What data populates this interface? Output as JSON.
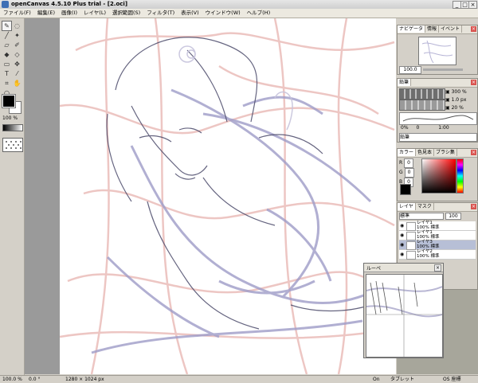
{
  "window": {
    "title": "openCanvas 4.5.10 Plus trial - [2.oci]",
    "controls": [
      "_",
      "□",
      "×"
    ]
  },
  "menu": [
    "ファイル(F)",
    "編集(E)",
    "画像(I)",
    "レイヤ(L)",
    "選択範囲(S)",
    "フィルタ(T)",
    "表示(V)",
    "ウインドウ(W)",
    "ヘルプ(H)"
  ],
  "toolbox": {
    "tools": [
      {
        "name": "pen-tool-icon",
        "glyph": "✎"
      },
      {
        "name": "lasso-tool-icon",
        "glyph": "◌"
      },
      {
        "name": "brush-tool-icon",
        "glyph": "╱"
      },
      {
        "name": "airbrush-tool-icon",
        "glyph": "✦"
      },
      {
        "name": "eraser-tool-icon",
        "glyph": "▱"
      },
      {
        "name": "water-tool-icon",
        "glyph": "✐"
      },
      {
        "name": "fill-tool-icon",
        "glyph": "◆"
      },
      {
        "name": "transform-tool-icon",
        "glyph": "◇"
      },
      {
        "name": "select-tool-icon",
        "glyph": "▭"
      },
      {
        "name": "move-tool-icon",
        "glyph": "✥"
      },
      {
        "name": "text-tool-icon",
        "glyph": "T"
      },
      {
        "name": "eyedropper-tool-icon",
        "glyph": "⁄"
      },
      {
        "name": "crop-tool-icon",
        "glyph": "⌗"
      },
      {
        "name": "hand-tool-icon",
        "glyph": "✋"
      },
      {
        "name": "zoom-tool-icon",
        "glyph": "○"
      }
    ],
    "zoom_percent": "100",
    "zoom_unit": "%"
  },
  "navigator": {
    "tabs": [
      "ナビゲータ",
      "情報",
      "イベント"
    ],
    "zoom_value": "100.0"
  },
  "brush": {
    "title": "鉛筆",
    "size_value": "300",
    "size_unit": "%",
    "width_value": "1.0",
    "width_unit": "px",
    "opacity_value": "20",
    "opacity_unit": "%",
    "min_label": "0%",
    "zero_label": "0",
    "scale_label": "1:00",
    "name": "鉛筆"
  },
  "color": {
    "tabs": [
      "カラー",
      "色見本",
      "ブラシ集"
    ],
    "r": "0",
    "g": "0",
    "b": "0"
  },
  "layers": {
    "tabs": [
      "レイヤ",
      "マスク"
    ],
    "mode": "標準",
    "opacity": "100",
    "items": [
      {
        "name": "レイヤ1",
        "info": "100% 標準"
      },
      {
        "name": "レイヤ1",
        "info": "100% 標準"
      },
      {
        "name": "レイヤ3",
        "info": "100% 標準"
      },
      {
        "name": "レイヤ2",
        "info": "100% 標準"
      }
    ]
  },
  "loupe": {
    "title": "ルーペ"
  },
  "status": {
    "zoom": "100.0 %",
    "angle": "0.0 °",
    "size": "1280 × 1024 px",
    "pen_state": "On",
    "device": "タブレット",
    "coords": "OS 座標"
  }
}
